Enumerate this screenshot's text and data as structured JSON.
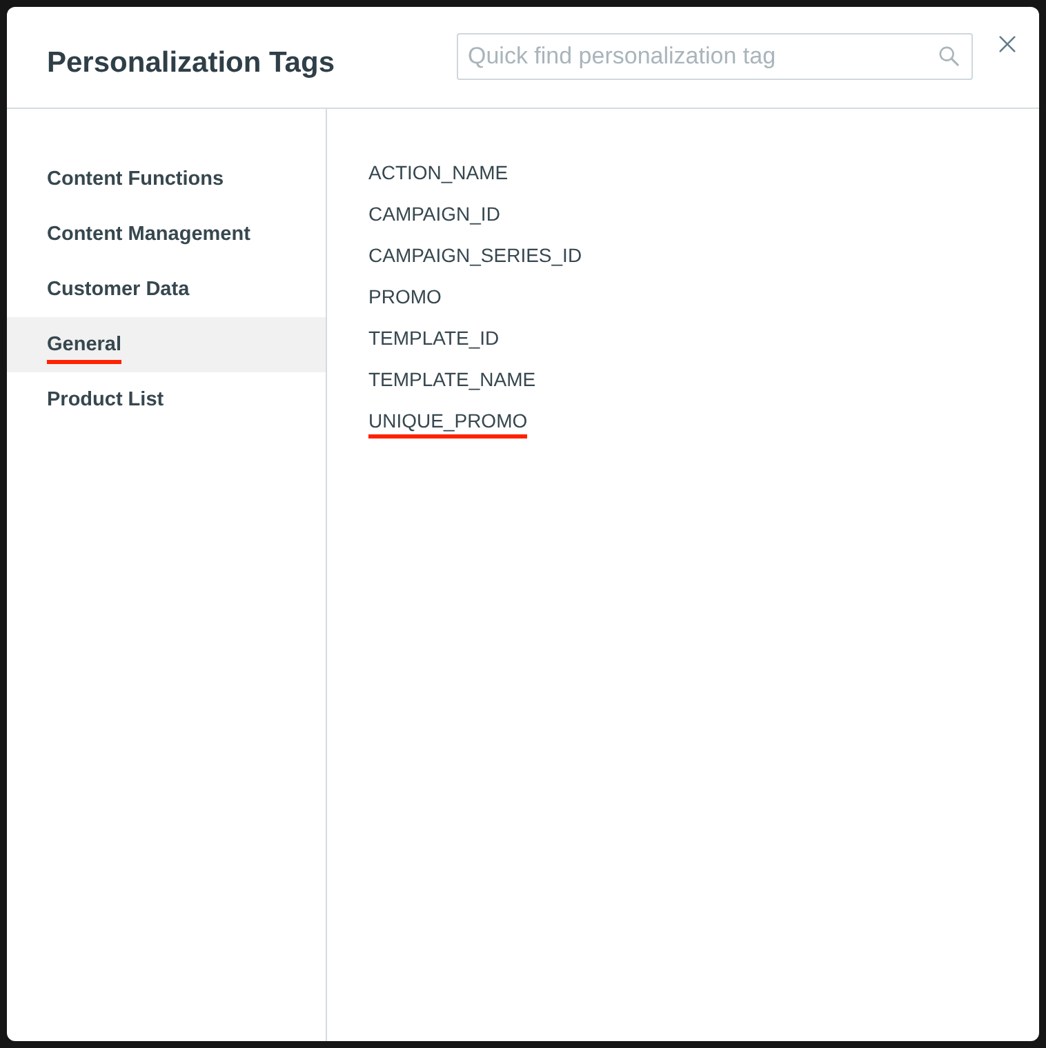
{
  "dialog": {
    "title": "Personalization Tags",
    "search": {
      "placeholder": "Quick find personalization tag"
    }
  },
  "sidebar": {
    "items": [
      {
        "label": "Content Functions",
        "selected": false,
        "underlined": false
      },
      {
        "label": "Content Management",
        "selected": false,
        "underlined": false
      },
      {
        "label": "Customer Data",
        "selected": false,
        "underlined": false
      },
      {
        "label": "General",
        "selected": true,
        "underlined": true
      },
      {
        "label": "Product List",
        "selected": false,
        "underlined": false
      }
    ]
  },
  "tags": [
    {
      "label": "ACTION_NAME",
      "underlined": false
    },
    {
      "label": "CAMPAIGN_ID",
      "underlined": false
    },
    {
      "label": "CAMPAIGN_SERIES_ID",
      "underlined": false
    },
    {
      "label": "PROMO",
      "underlined": false
    },
    {
      "label": "TEMPLATE_ID",
      "underlined": false
    },
    {
      "label": "TEMPLATE_NAME",
      "underlined": false
    },
    {
      "label": "UNIQUE_PROMO",
      "underlined": true
    }
  ]
}
